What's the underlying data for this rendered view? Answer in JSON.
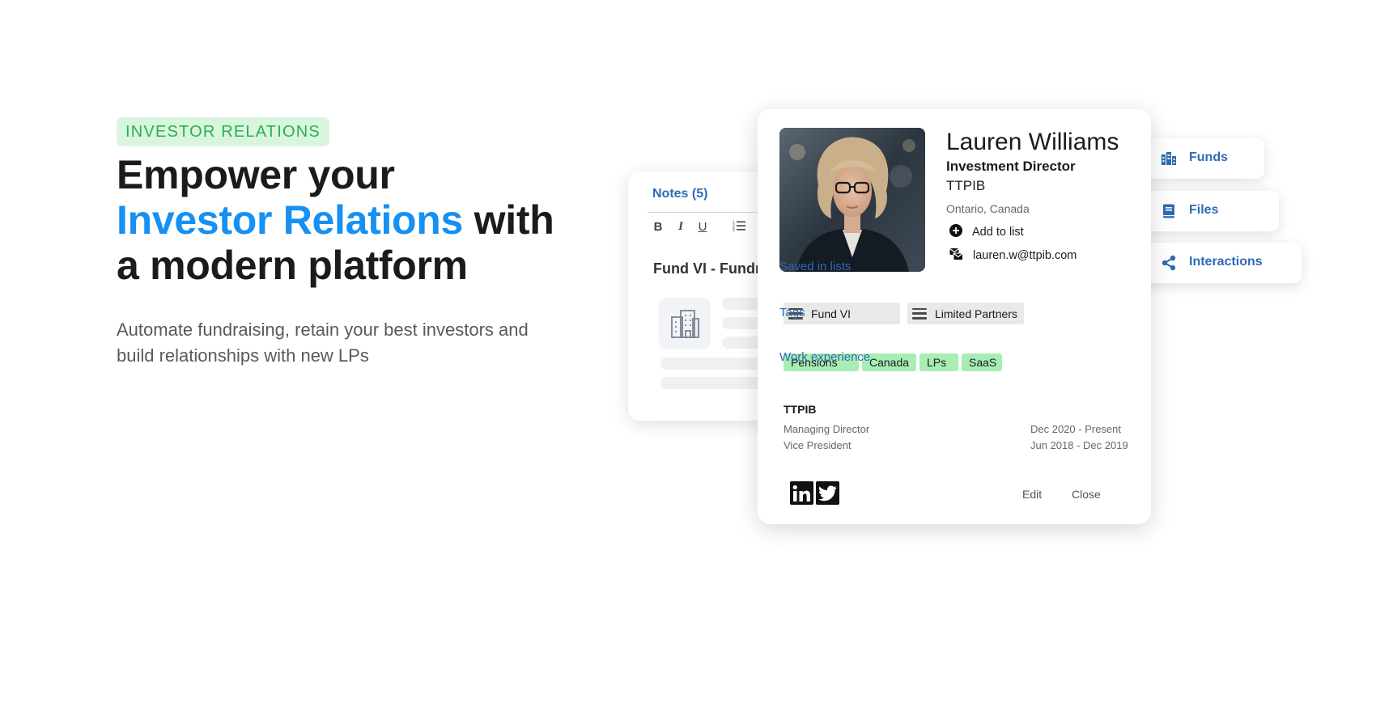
{
  "hero": {
    "eyebrow": "INVESTOR RELATIONS",
    "headline_line1": "Empower your",
    "headline_accent": "Investor Relations",
    "headline_with": " with",
    "headline_line3": "a modern platform",
    "subtext": "Automate fundraising, retain your best investors and build relationships with new LPs"
  },
  "notes": {
    "title": "Notes (5)",
    "toolbar": {
      "bold": "B",
      "italic": "I",
      "underline": "U"
    },
    "doc_title": "Fund VI - Fundraising"
  },
  "profile": {
    "name": "Lauren Williams",
    "role": "Investment Director",
    "organization": "TTPIB",
    "location": "Ontario, Canada",
    "add_to_list_label": "Add to list",
    "email": "lauren.w@ttpib.com",
    "saved_in_lists_label": "Saved in lists",
    "saved_lists": [
      "Fund VI",
      "Limited Partners"
    ],
    "tags_label": "Tags",
    "tags": [
      "Pensions",
      "Canada",
      "LPs",
      "SaaS"
    ],
    "work_experience_label": "Work experience",
    "work_experience": {
      "company": "TTPIB",
      "positions": [
        {
          "title": "Managing Director",
          "dates": "Dec 2020 - Present"
        },
        {
          "title": "Vice President",
          "dates": "Jun 2018 - Dec 2019"
        }
      ]
    },
    "edit_label": "Edit",
    "close_label": "Close"
  },
  "side_tabs": [
    {
      "label": "Funds",
      "icon": "buildings-icon"
    },
    {
      "label": "Files",
      "icon": "book-icon"
    },
    {
      "label": "Interactions",
      "icon": "share-icon"
    }
  ],
  "colors": {
    "accent_blue": "#1690f2",
    "link_blue": "#2f6bb3",
    "eyebrow_bg": "#d9f5de",
    "eyebrow_text": "#28b14c",
    "tag_green": "#a8edb4",
    "list_chip_gray": "#e9e9e9"
  }
}
